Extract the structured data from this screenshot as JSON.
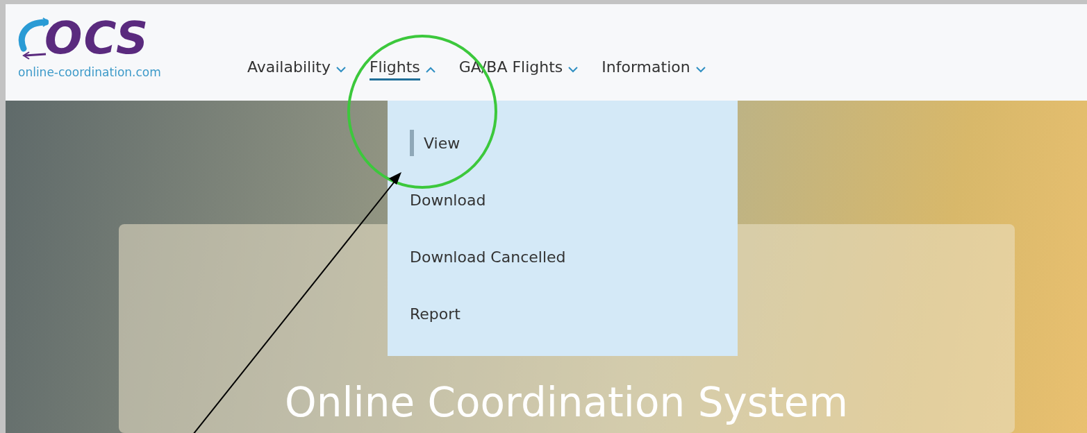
{
  "logo": {
    "mark": "OCS",
    "domain": "online-coordination.com"
  },
  "nav": [
    {
      "label": "Availability",
      "expanded": false,
      "selected": false
    },
    {
      "label": "Flights",
      "expanded": true,
      "selected": true
    },
    {
      "label": "GA/BA Flights",
      "expanded": false,
      "selected": false
    },
    {
      "label": "Information",
      "expanded": false,
      "selected": false
    }
  ],
  "flights_menu": [
    {
      "label": "View",
      "selected": true
    },
    {
      "label": "Download",
      "selected": false
    },
    {
      "label": "Download Cancelled",
      "selected": false
    },
    {
      "label": "Report",
      "selected": false
    }
  ],
  "hero": {
    "title": "Online Coordination System"
  }
}
